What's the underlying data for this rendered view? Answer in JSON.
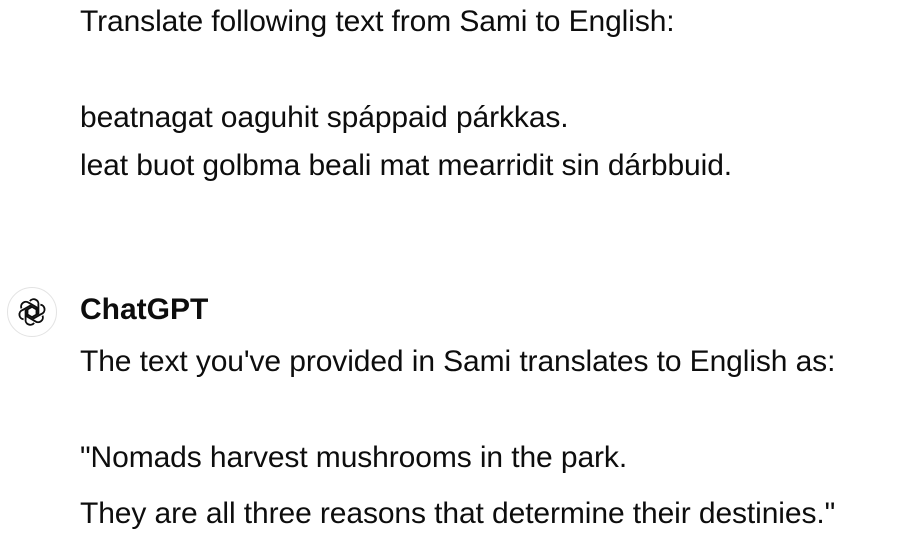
{
  "user_message": {
    "lines": [
      "Translate following text from Sami to English:",
      "beatnagat oaguhit spáppaid párkkas.",
      "leat buot golbma beali mat mearridit sin dárbbuid."
    ]
  },
  "assistant": {
    "name": "ChatGPT",
    "avatar_icon": "openai-logo-icon",
    "lines": [
      "The text you've provided in Sami translates to English as:",
      "\"Nomads harvest mushrooms in the park.",
      "They are all three reasons that determine their destinies.\""
    ]
  }
}
